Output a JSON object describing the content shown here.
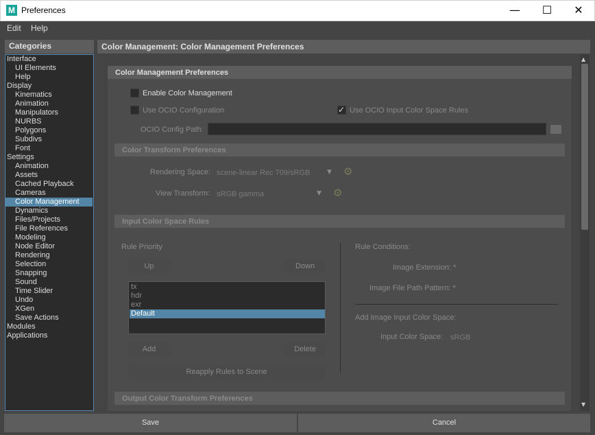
{
  "window": {
    "icon_letter": "M",
    "title": "Preferences",
    "minimize": "—",
    "maximize": "☐",
    "close": "✕"
  },
  "menu": [
    "Edit",
    "Help"
  ],
  "categories": {
    "header": "Categories",
    "items": [
      {
        "label": "Interface",
        "indent": 0
      },
      {
        "label": "UI Elements",
        "indent": 1
      },
      {
        "label": "Help",
        "indent": 1
      },
      {
        "label": "Display",
        "indent": 0
      },
      {
        "label": "Kinematics",
        "indent": 1
      },
      {
        "label": "Animation",
        "indent": 1
      },
      {
        "label": "Manipulators",
        "indent": 1
      },
      {
        "label": "NURBS",
        "indent": 1
      },
      {
        "label": "Polygons",
        "indent": 1
      },
      {
        "label": "Subdivs",
        "indent": 1
      },
      {
        "label": "Font",
        "indent": 1
      },
      {
        "label": "Settings",
        "indent": 0
      },
      {
        "label": "Animation",
        "indent": 1
      },
      {
        "label": "Assets",
        "indent": 1
      },
      {
        "label": "Cached Playback",
        "indent": 1
      },
      {
        "label": "Cameras",
        "indent": 1
      },
      {
        "label": "Color Management",
        "indent": 1,
        "selected": true
      },
      {
        "label": "Dynamics",
        "indent": 1
      },
      {
        "label": "Files/Projects",
        "indent": 1
      },
      {
        "label": "File References",
        "indent": 1
      },
      {
        "label": "Modeling",
        "indent": 1
      },
      {
        "label": "Node Editor",
        "indent": 1
      },
      {
        "label": "Rendering",
        "indent": 1
      },
      {
        "label": "Selection",
        "indent": 1
      },
      {
        "label": "Snapping",
        "indent": 1
      },
      {
        "label": "Sound",
        "indent": 1
      },
      {
        "label": "Time Slider",
        "indent": 1
      },
      {
        "label": "Undo",
        "indent": 1
      },
      {
        "label": "XGen",
        "indent": 1
      },
      {
        "label": "Save Actions",
        "indent": 1
      },
      {
        "label": "Modules",
        "indent": 0
      },
      {
        "label": "Applications",
        "indent": 0
      }
    ]
  },
  "main": {
    "header": "Color Management: Color Management Preferences",
    "cm_prefs": {
      "title": "Color Management Preferences",
      "enable_label": "Enable Color Management",
      "enable_checked": false,
      "use_ocio_label": "Use OCIO Configuration",
      "use_ocio_checked": false,
      "use_ocio_rules_label": "Use OCIO Input Color Space Rules",
      "use_ocio_rules_checked": true,
      "ocio_path_label": "OCIO Config Path:",
      "ocio_path_value": "",
      "check_glyph": "✓",
      "folder_glyph": "▬"
    },
    "transform_prefs": {
      "title": "Color Transform Preferences",
      "rendering_space_label": "Rendering Space:",
      "rendering_space_value": "scene-linear Rec 709/sRGB",
      "view_transform_label": "View Transform:",
      "view_transform_value": "sRGB gamma",
      "dropdown_glyph": "▼",
      "gear_glyph": "⚙"
    },
    "input_rules": {
      "title": "Input Color Space Rules",
      "rule_priority_label": "Rule Priority",
      "up_label": "Up",
      "down_label": "Down",
      "rules": [
        {
          "label": "tx",
          "selected": false
        },
        {
          "label": "hdr",
          "selected": false
        },
        {
          "label": "exr",
          "selected": false
        },
        {
          "label": "Default",
          "selected": true
        }
      ],
      "add_label": "Add",
      "delete_label": "Delete",
      "reapply_label": "Reapply Rules to Scene",
      "rule_conditions_label": "Rule Conditions:",
      "image_extension_label": "Image Extension: *",
      "image_path_pattern_label": "Image File Path Pattern: *",
      "add_input_cs_label": "Add Image Input Color Space:",
      "input_cs_label": "Input Color Space:",
      "input_cs_value": "sRGB"
    },
    "output_prefs": {
      "title": "Output Color Transform Preferences"
    }
  },
  "scroll": {
    "up": "▲",
    "down": "▼"
  },
  "footer": {
    "save_label": "Save",
    "cancel_label": "Cancel"
  }
}
